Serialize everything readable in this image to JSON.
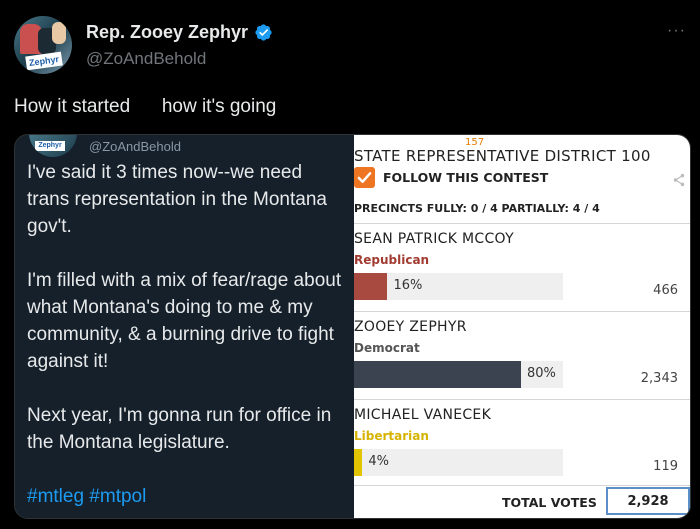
{
  "tweet": {
    "display_name": "Rep. Zooey Zephyr",
    "handle": "@ZoAndBehold",
    "text": "How it started      how it's going",
    "more_label": "···",
    "avatar_text": "Zephyr"
  },
  "quoted": {
    "handle": "@ZoAndBehold",
    "avatar_text": "Zephyr",
    "paragraphs": [
      "I've said it 3 times now--we need trans representation in the Montana gov't.",
      "I'm filled with a mix of fear/rage about what Montana's doing to me & my community, & a burning drive to fight against it!",
      "Next year, I'm gonna run for office in the Montana legislature."
    ],
    "hashtags": "#mtleg #mtpol"
  },
  "results": {
    "marker": "157",
    "title": "STATE REPRESENTATIVE DISTRICT 100",
    "follow_label": "FOLLOW THIS CONTEST",
    "precincts": "PRECINCTS FULLY: 0 / 4 PARTIALLY: 4 / 4",
    "candidates": [
      {
        "name": "SEAN PATRICK MCCOY",
        "party": "Republican",
        "percent": 16,
        "percent_label": "16%",
        "votes": "466",
        "party_color": "#a23b31",
        "bar_color": "#a84a3f"
      },
      {
        "name": "ZOOEY ZEPHYR",
        "party": "Democrat",
        "percent": 80,
        "percent_label": "80%",
        "votes": "2,343",
        "party_color": "#555555",
        "bar_color": "#3b4250"
      },
      {
        "name": "MICHAEL VANECEK",
        "party": "Libertarian",
        "percent": 4,
        "percent_label": "4%",
        "votes": "119",
        "party_color": "#d6b300",
        "bar_color": "#e2c400"
      }
    ],
    "total_label": "TOTAL VOTES",
    "total_value": "2,928"
  }
}
